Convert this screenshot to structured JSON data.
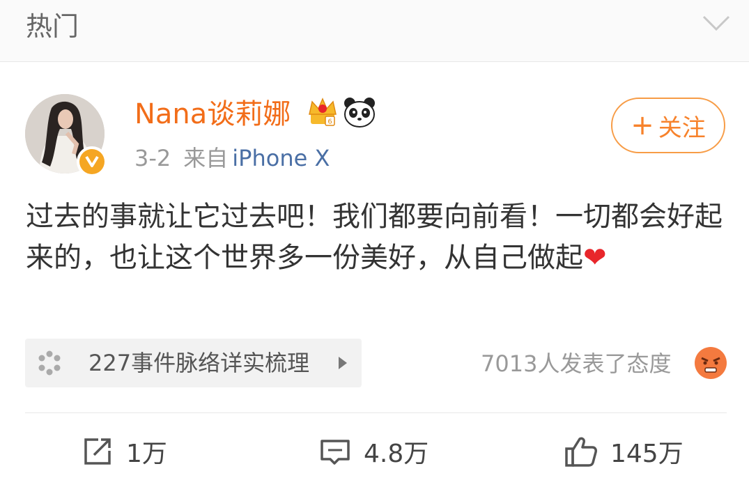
{
  "header": {
    "title": "热门",
    "collapse_icon": "chevron-down-icon"
  },
  "post": {
    "username": "Nana谈莉娜",
    "date": "3-2",
    "source_prefix": "来自",
    "source": "iPhone X",
    "follow_label": "关注",
    "follow_plus": "+",
    "content": "过去的事就让它过去吧！我们都要向前看！一切都会好起来的，也让这个世界多一份美好，从自己做起",
    "content_emoji": "❤",
    "badges": [
      "crown-member-icon",
      "panda-icon",
      "verified-icon"
    ]
  },
  "topic": {
    "label": "227事件脉络详实梳理",
    "icon": "topic-dots-icon"
  },
  "reaction": {
    "text": "7013人发表了态度",
    "icon": "angry-face-icon"
  },
  "actions": {
    "repost_count": "1万",
    "comment_count": "4.8万",
    "like_count": "145万"
  },
  "colors": {
    "username": "#f26d19",
    "follow_border": "#f79c46",
    "source_link": "#4a6fa5",
    "verified_badge": "#f5a623"
  }
}
